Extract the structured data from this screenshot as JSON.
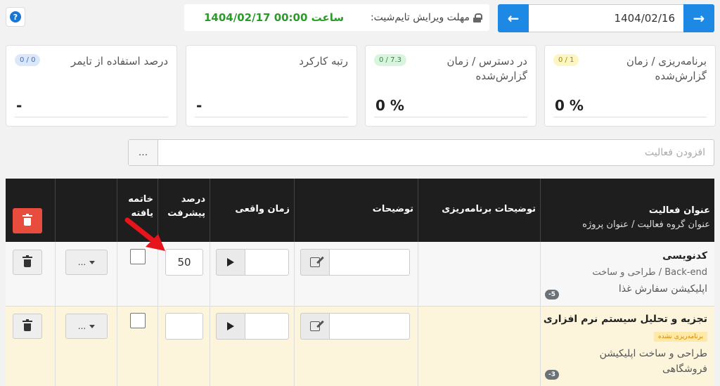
{
  "topbar": {
    "help_label": "?",
    "deadline_label": "مهلت ویرایش تایم‌شیت:",
    "deadline_value": "1404/02/17 ساعت 00:00",
    "current_date": "1404/02/16",
    "prev_arrow": "←",
    "next_arrow": "→"
  },
  "cards": [
    {
      "title": "برنامه‌ریزی / زمان گزارش‌شده",
      "badge": "0 / 1",
      "badge_color": "#fdf6c3",
      "badge_text_color": "#a08a00",
      "value": "0 %"
    },
    {
      "title": "در دسترس / زمان گزارش‌شده",
      "badge": "0 / 7.3",
      "badge_color": "#d9f5dd",
      "badge_text_color": "#2f8a3e",
      "value": "0 %"
    },
    {
      "title": "رتبه کارکرد",
      "badge": "",
      "value": "-"
    },
    {
      "title": "درصد استفاده از تایمر",
      "badge": "0 / 0",
      "badge_color": "#dbe8fb",
      "badge_text_color": "#3b6fc2",
      "value": "-"
    }
  ],
  "add_activity": {
    "placeholder": "افزودن فعالیت",
    "more_label": "..."
  },
  "table": {
    "headers": {
      "activity_title": "عنوان فعالیت",
      "activity_subtitle": "عنوان گروه فعالیت  /  عنوان پروژه",
      "planning_desc": "توضیحات برنامه‌ریزی",
      "desc": "توضیحات",
      "actual_time": "زمان واقعی",
      "progress": "درصد پیشرفت",
      "finished": "خاتمه یافته"
    },
    "rows": [
      {
        "title": "کدنویسی",
        "group": "Back-end  /  طراحی و ساخت",
        "project": "اپلیکیشن سفارش غذا",
        "count": "-5",
        "unplanned": "",
        "progress": "50",
        "more_label": "..."
      },
      {
        "title": "تجزیه و تحلیل سیستم نرم افزاری",
        "unplanned": "برنامه‌ریزی نشده",
        "project": "طراحی و ساخت اپلیکیشن فروشگاهی",
        "count": "-3",
        "progress": "",
        "more_label": "..."
      }
    ]
  },
  "colors": {
    "accent": "#1e88e5",
    "deadline_green": "#2e9a2e",
    "danger": "#e74c3c",
    "header_dark": "#1e1e1e",
    "row_highlight": "#fcf5dc",
    "annotation_arrow": "#e8141c"
  }
}
